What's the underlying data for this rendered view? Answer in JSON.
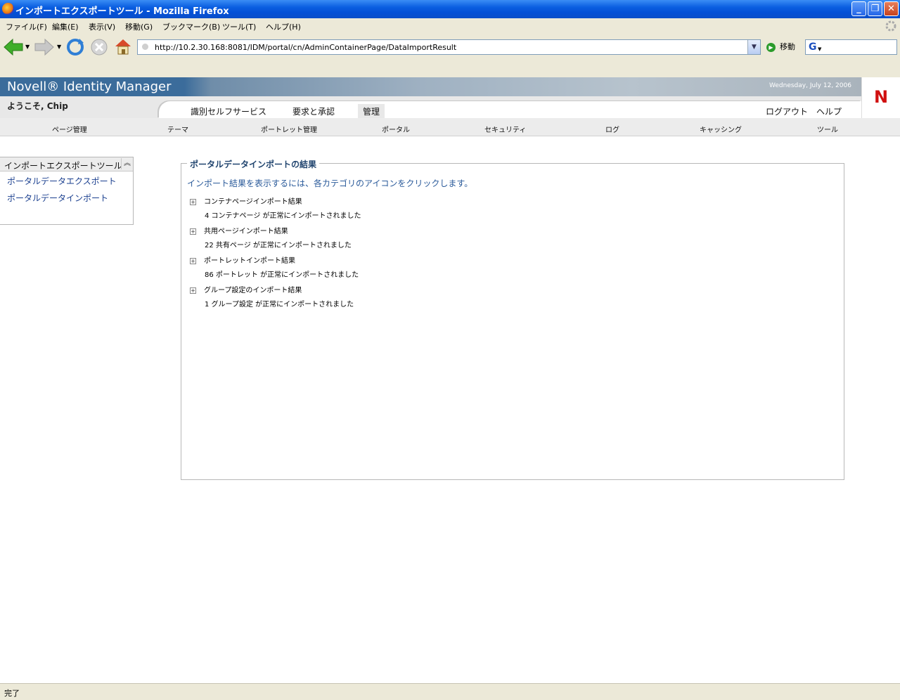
{
  "window": {
    "title": "インポートエクスポートツール - Mozilla Firefox",
    "minimize": "_",
    "restore": "❐",
    "close": "✕"
  },
  "menubar": [
    "ファイル(F)",
    "編集(E)",
    "表示(V)",
    "移動(G)",
    "ブックマーク(B)",
    "ツール(T)",
    "ヘルプ(H)"
  ],
  "navbar": {
    "url": "http://10.2.30.168:8081/IDM/portal/cn/AdminContainerPage/DataImportResult",
    "go_label": "移動",
    "search_engine": "G",
    "icons": [
      "back-icon",
      "forward-icon",
      "reload-icon",
      "stop-icon",
      "home-icon"
    ]
  },
  "app": {
    "brand": "Novell® Identity Manager",
    "date": "Wednesday, July 12, 2006",
    "welcome": "ようこそ, Chip",
    "logo_letter": "N",
    "tabs": [
      "識別セルフサービス",
      "要求と承認",
      "管理"
    ],
    "selected_tab": "管理",
    "logout": "ログアウト",
    "help": "ヘルプ",
    "subnav": [
      "ページ管理",
      "テーマ",
      "ポートレット管理",
      "ポータル",
      "セキュリティ",
      "ログ",
      "キャッシング",
      "ツール"
    ]
  },
  "sidebar": {
    "title": "インポートエクスポートツール",
    "collapse_glyph": "︽",
    "links": [
      "ポータルデータエクスポート",
      "ポータルデータインポート"
    ]
  },
  "panel": {
    "legend": "ポータルデータインポートの結果",
    "instruction": "インポート結果を表示するには、各カテゴリのアイコンをクリックします。",
    "expander_glyph": "+",
    "categories": [
      {
        "label": "コンテナページインポート結果",
        "result": "4 コンテナページ が正常にインポートされました"
      },
      {
        "label": "共用ページインポート結果",
        "result": "22 共有ページ が正常にインポートされました"
      },
      {
        "label": "ポートレットインポート結果",
        "result": "86 ポートレット が正常にインポートされました"
      },
      {
        "label": "グループ設定のインポート結果",
        "result": "1 グループ設定 が正常にインポートされました"
      }
    ]
  },
  "status": "完了",
  "colors": {
    "titlebar": "#0a5ee0",
    "brand_bg": "#3b6c9b",
    "link": "#1a3f8f",
    "legend": "#21456f",
    "logo": "#d01010"
  }
}
